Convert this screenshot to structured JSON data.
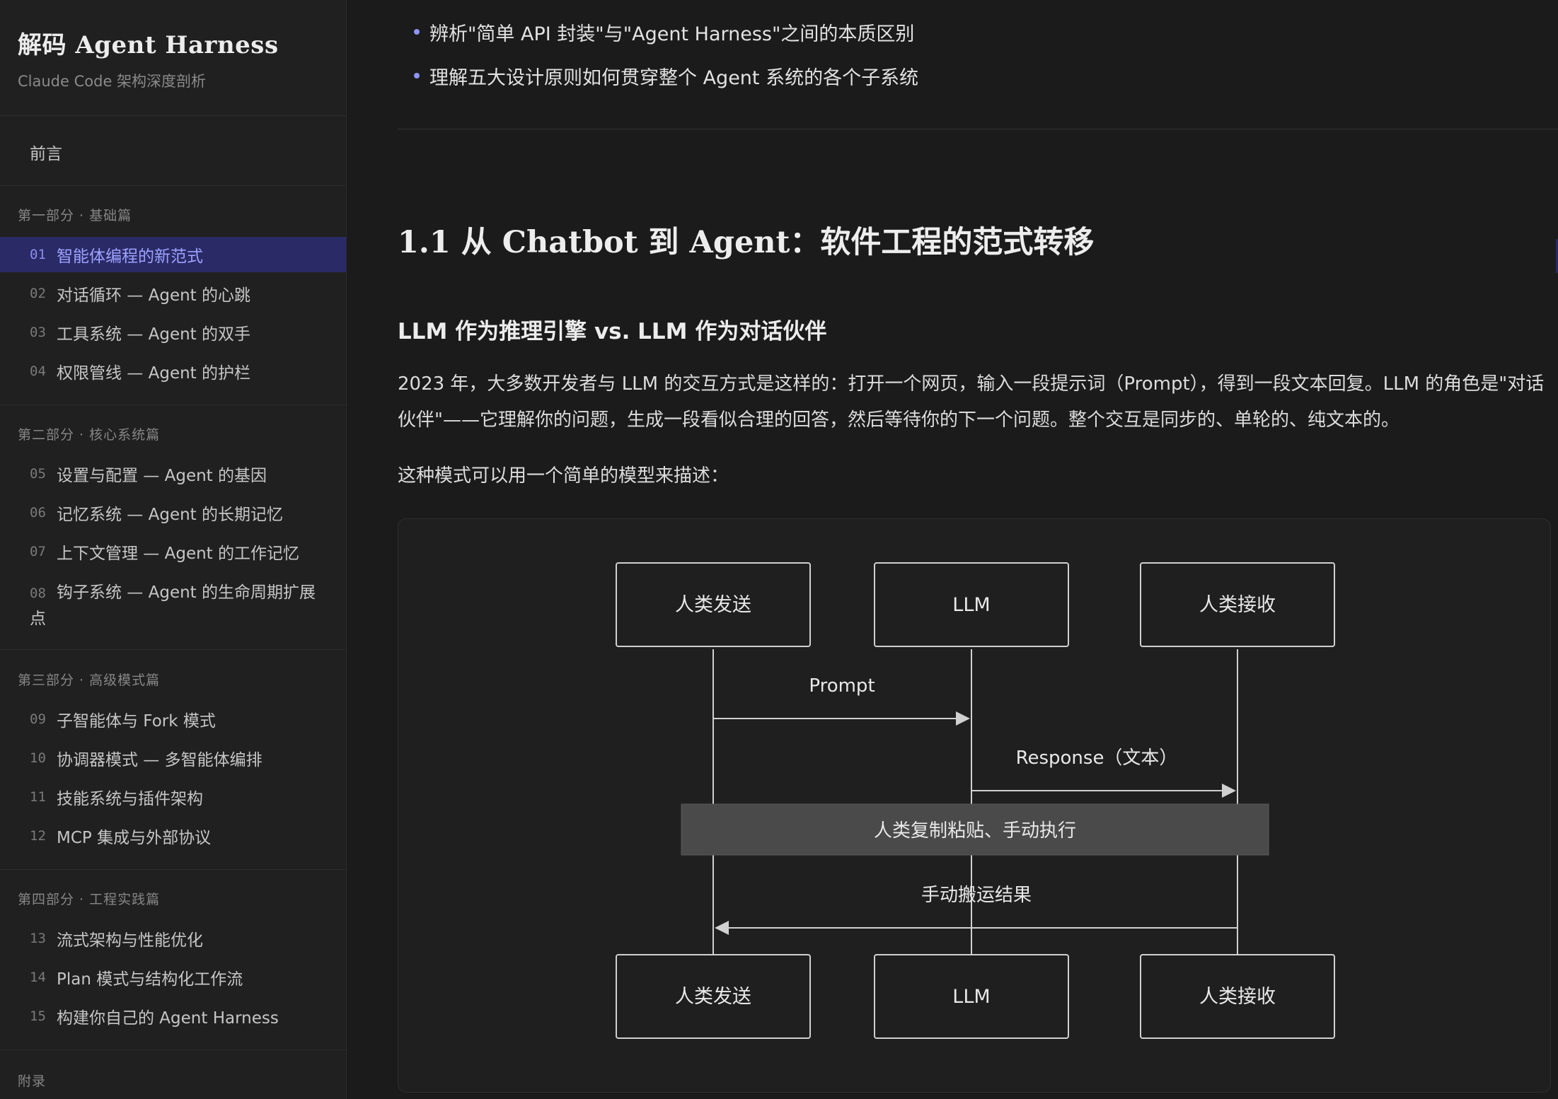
{
  "sidebar": {
    "brand_title": "解码 Agent Harness",
    "brand_subtitle": "Claude Code 架构深度剖析",
    "preface": "前言",
    "sections": [
      {
        "label": "第一部分 · 基础篇"
      },
      {
        "label": "第二部分 · 核心系统篇"
      },
      {
        "label": "第三部分 · 高级模式篇"
      },
      {
        "label": "第四部分 · 工程实践篇"
      },
      {
        "label": "附录"
      }
    ],
    "chapters": [
      {
        "num": "01",
        "title": "智能体编程的新范式",
        "active": true
      },
      {
        "num": "02",
        "title": "对话循环 — Agent 的心跳"
      },
      {
        "num": "03",
        "title": "工具系统 — Agent 的双手"
      },
      {
        "num": "04",
        "title": "权限管线 — Agent 的护栏"
      },
      {
        "num": "05",
        "title": "设置与配置 — Agent 的基因"
      },
      {
        "num": "06",
        "title": "记忆系统 — Agent 的长期记忆"
      },
      {
        "num": "07",
        "title": "上下文管理 — Agent 的工作记忆"
      },
      {
        "num": "08",
        "title": "钩子系统 — Agent 的生命周期扩展点"
      },
      {
        "num": "09",
        "title": "子智能体与 Fork 模式"
      },
      {
        "num": "10",
        "title": "协调器模式 — 多智能体编排"
      },
      {
        "num": "11",
        "title": "技能系统与插件架构"
      },
      {
        "num": "12",
        "title": "MCP 集成与外部协议"
      },
      {
        "num": "13",
        "title": "流式架构与性能优化"
      },
      {
        "num": "14",
        "title": "Plan 模式与结构化工作流"
      },
      {
        "num": "15",
        "title": "构建你自己的 Agent Harness"
      }
    ]
  },
  "main": {
    "bullets": [
      "辨析\"简单 API 封装\"与\"Agent Harness\"之间的本质区别",
      "理解五大设计原则如何贯穿整个 Agent 系统的各个子系统"
    ],
    "heading": "1.1 从 Chatbot 到 Agent：软件工程的范式转移",
    "subheading": "LLM 作为推理引擎 vs. LLM 作为对话伙伴",
    "paragraph": "2023 年，大多数开发者与 LLM 的交互方式是这样的：打开一个网页，输入一段提示词（Prompt），得到一段文本回复。LLM 的角色是\"对话伙伴\"——它理解你的问题，生成一段看似合理的回答，然后等待你的下一个问题。整个交互是同步的、单轮的、纯文本的。",
    "paragraph2": "这种模式可以用一个简单的模型来描述："
  },
  "diagram": {
    "participants": [
      "人类发送",
      "LLM",
      "人类接收"
    ],
    "messages": [
      {
        "label": "Prompt"
      },
      {
        "label": "Response（文本）"
      },
      {
        "label": "手动搬运结果"
      }
    ],
    "note": "人类复制粘贴、手动执行",
    "colors": {
      "stroke": "#d0d0d0",
      "box_fill": "#1f1f1f",
      "note_fill": "#4a4a4a",
      "text": "#e8e8e8"
    }
  }
}
